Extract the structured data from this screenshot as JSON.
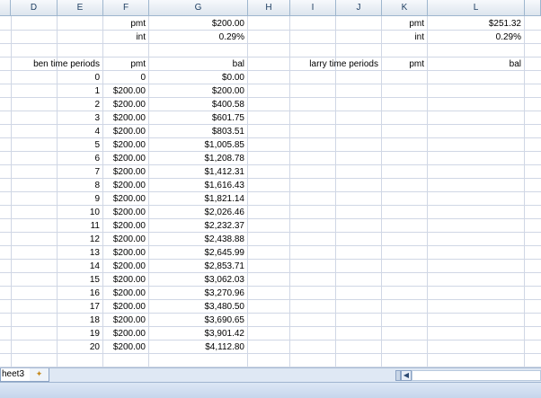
{
  "columns": [
    "D",
    "E",
    "F",
    "G",
    "H",
    "I",
    "J",
    "K",
    "L"
  ],
  "header_row": {
    "ben_pmt_label": "pmt",
    "ben_pmt_value": "$200.00",
    "larry_pmt_label": "pmt",
    "larry_pmt_value": "$251.32"
  },
  "int_row": {
    "ben_int_label": "int",
    "ben_int_value": "0.29%",
    "larry_int_label": "int",
    "larry_int_value": "0.29%"
  },
  "table_headers": {
    "ben_periods": "ben time periods",
    "ben_pmt": "pmt",
    "ben_bal": "bal",
    "larry_periods": "larry time periods",
    "larry_pmt": "pmt",
    "larry_bal": "bal"
  },
  "rows": [
    {
      "period": "0",
      "pmt": "0",
      "bal": "$0.00"
    },
    {
      "period": "1",
      "pmt": "$200.00",
      "bal": "$200.00"
    },
    {
      "period": "2",
      "pmt": "$200.00",
      "bal": "$400.58"
    },
    {
      "period": "3",
      "pmt": "$200.00",
      "bal": "$601.75"
    },
    {
      "period": "4",
      "pmt": "$200.00",
      "bal": "$803.51"
    },
    {
      "period": "5",
      "pmt": "$200.00",
      "bal": "$1,005.85"
    },
    {
      "period": "6",
      "pmt": "$200.00",
      "bal": "$1,208.78"
    },
    {
      "period": "7",
      "pmt": "$200.00",
      "bal": "$1,412.31"
    },
    {
      "period": "8",
      "pmt": "$200.00",
      "bal": "$1,616.43"
    },
    {
      "period": "9",
      "pmt": "$200.00",
      "bal": "$1,821.14"
    },
    {
      "period": "10",
      "pmt": "$200.00",
      "bal": "$2,026.46"
    },
    {
      "period": "11",
      "pmt": "$200.00",
      "bal": "$2,232.37"
    },
    {
      "period": "12",
      "pmt": "$200.00",
      "bal": "$2,438.88"
    },
    {
      "period": "13",
      "pmt": "$200.00",
      "bal": "$2,645.99"
    },
    {
      "period": "14",
      "pmt": "$200.00",
      "bal": "$2,853.71"
    },
    {
      "period": "15",
      "pmt": "$200.00",
      "bal": "$3,062.03"
    },
    {
      "period": "16",
      "pmt": "$200.00",
      "bal": "$3,270.96"
    },
    {
      "period": "17",
      "pmt": "$200.00",
      "bal": "$3,480.50"
    },
    {
      "period": "18",
      "pmt": "$200.00",
      "bal": "$3,690.65"
    },
    {
      "period": "19",
      "pmt": "$200.00",
      "bal": "$3,901.42"
    },
    {
      "period": "20",
      "pmt": "$200.00",
      "bal": "$4,112.80"
    }
  ],
  "tabs": {
    "sheet_label": "heet3",
    "new_sheet_icon": "insert-worksheet-icon"
  },
  "colors": {
    "header_text": "#1f3f62",
    "gridline": "#d0d7e5",
    "header_border": "#9eb6ce"
  }
}
